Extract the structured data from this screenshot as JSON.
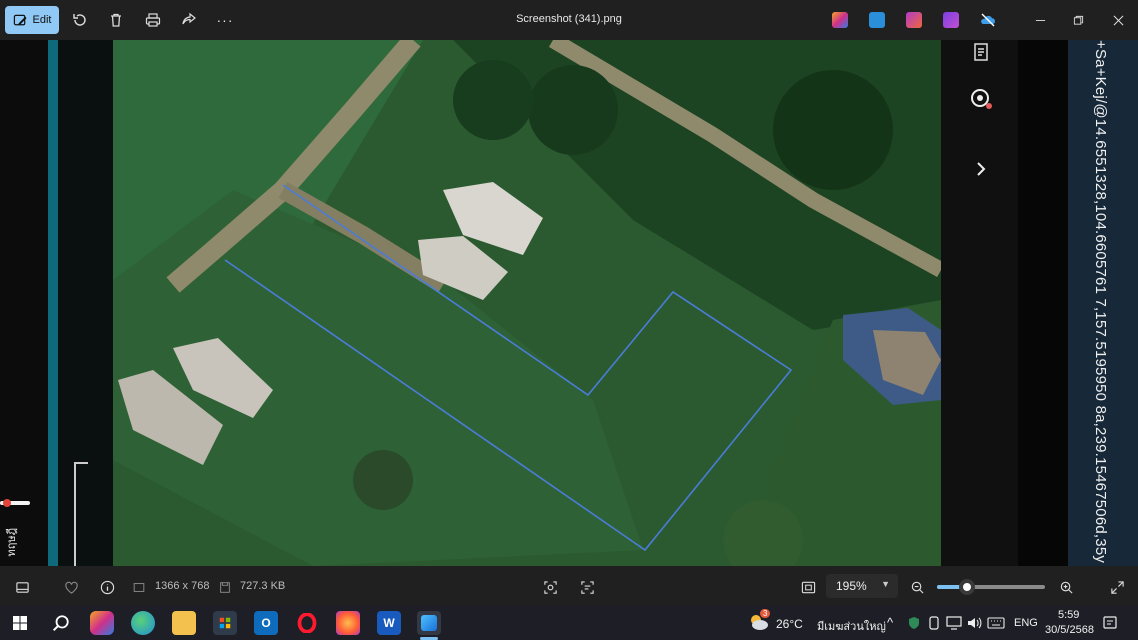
{
  "titlebar": {
    "edit_label": "Edit",
    "title": "Screenshot (341).png",
    "more_label": "···"
  },
  "image": {
    "url_overlay": "+Sa+Kej/@14.6551328,104.6605761 7,157.5195950 8a,239.15467506d,35y",
    "left_overlay": "ทฤษฎี"
  },
  "statusbar": {
    "dimensions": "1366 x 768",
    "file_size": "727.3 KB",
    "zoom": "195%",
    "zoom_level_fraction": 0.28
  },
  "taskbar": {
    "weather_temp": "26°C",
    "weather_desc": "มีเมฆส่วนใหญ่",
    "weather_badge": "3",
    "language": "ENG",
    "time": "5:59",
    "date": "30/5/2568"
  }
}
